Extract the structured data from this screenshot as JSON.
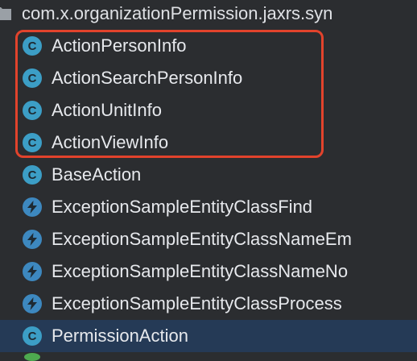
{
  "package": {
    "label": "com.x.organizationPermission.jaxrs.syn",
    "icon": "folder-icon"
  },
  "items": [
    {
      "label": "ActionPersonInfo",
      "icon": "class-icon",
      "selected": false
    },
    {
      "label": "ActionSearchPersonInfo",
      "icon": "class-icon",
      "selected": false
    },
    {
      "label": "ActionUnitInfo",
      "icon": "class-icon",
      "selected": false
    },
    {
      "label": "ActionViewInfo",
      "icon": "class-icon",
      "selected": false
    },
    {
      "label": "BaseAction",
      "icon": "class-icon",
      "selected": false
    },
    {
      "label": "ExceptionSampleEntityClassFind",
      "icon": "exception-icon",
      "selected": false
    },
    {
      "label": "ExceptionSampleEntityClassNameEm",
      "icon": "exception-icon",
      "selected": false
    },
    {
      "label": "ExceptionSampleEntityClassNameNo",
      "icon": "exception-icon",
      "selected": false
    },
    {
      "label": "ExceptionSampleEntityClassProcess",
      "icon": "exception-icon",
      "selected": false
    },
    {
      "label": "PermissionAction",
      "icon": "class-icon",
      "selected": true
    }
  ],
  "class_icon_letter": "C",
  "colors": {
    "background": "#2b2d30",
    "selected_row": "#253a56",
    "class_icon": "#3c9ec6",
    "exception_icon": "#3d88bf",
    "highlight_border": "#e2432c",
    "text": "#e7e9ed"
  }
}
